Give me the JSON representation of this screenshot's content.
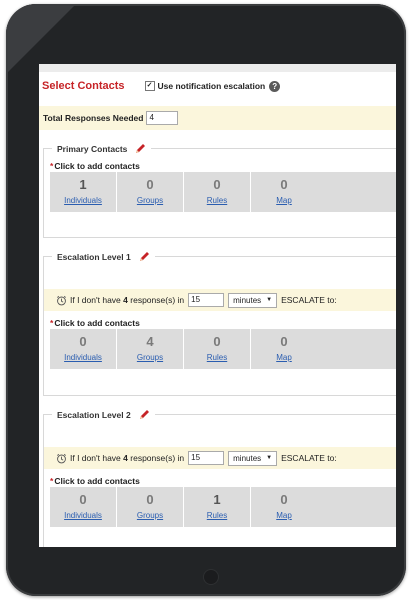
{
  "header": {
    "title": "Select Contacts",
    "escalation_label": "Use notification escalation",
    "escalation_checked": true,
    "help_icon": "question-circle-icon"
  },
  "total_responses": {
    "label": "Total Responses Needed",
    "value": "4"
  },
  "sections": [
    {
      "title": "Primary Contacts",
      "add_label": "Click to add contacts",
      "tiles": [
        {
          "count": "1",
          "label": "Individuals"
        },
        {
          "count": "0",
          "label": "Groups"
        },
        {
          "count": "0",
          "label": "Rules"
        },
        {
          "count": "0",
          "label": "Map"
        }
      ]
    },
    {
      "title": "Escalation Level 1",
      "condition": {
        "prefix": "If I don't have",
        "count": "4",
        "middle": "response(s) in",
        "value": "15",
        "unit": "minutes",
        "suffix": "ESCALATE to:"
      },
      "add_label": "Click to add contacts",
      "tiles": [
        {
          "count": "0",
          "label": "Individuals"
        },
        {
          "count": "4",
          "label": "Groups"
        },
        {
          "count": "0",
          "label": "Rules"
        },
        {
          "count": "0",
          "label": "Map"
        }
      ]
    },
    {
      "title": "Escalation Level 2",
      "condition": {
        "prefix": "If I don't have",
        "count": "4",
        "middle": "response(s) in",
        "value": "15",
        "unit": "minutes",
        "suffix": "ESCALATE to:"
      },
      "add_label": "Click to add contacts",
      "tiles": [
        {
          "count": "0",
          "label": "Individuals"
        },
        {
          "count": "0",
          "label": "Groups"
        },
        {
          "count": "1",
          "label": "Rules"
        },
        {
          "count": "0",
          "label": "Map"
        }
      ]
    }
  ],
  "colors": {
    "accent_red": "#c62327",
    "link_blue": "#2a5db0",
    "highlight_bg": "#fbf6dc",
    "tile_bg": "#dcdcdc",
    "device_frame": "#222426"
  }
}
